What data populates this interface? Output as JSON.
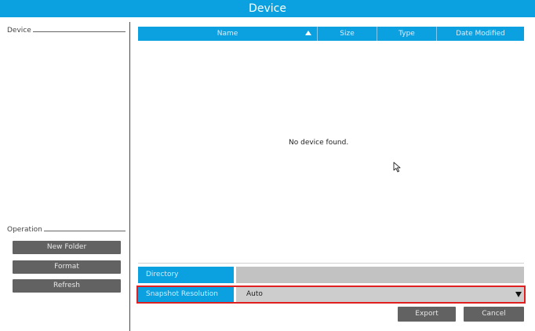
{
  "window": {
    "title": "Device"
  },
  "sidebar": {
    "device_group_label": "Device",
    "operation_group_label": "Operation",
    "buttons": {
      "new_folder": "New Folder",
      "format": "Format",
      "refresh": "Refresh"
    }
  },
  "table": {
    "columns": [
      "Name",
      "Size",
      "Type",
      "Date Modified"
    ],
    "sort_column": "Name",
    "empty_message": "No device found."
  },
  "form": {
    "directory_label": "Directory",
    "directory_value": "",
    "snapshot_label": "Snapshot Resolution",
    "snapshot_value": "Auto"
  },
  "actions": {
    "export": "Export",
    "cancel": "Cancel"
  },
  "colors": {
    "accent": "#0ba0e0",
    "button": "#626262",
    "highlight": "#e02020"
  }
}
